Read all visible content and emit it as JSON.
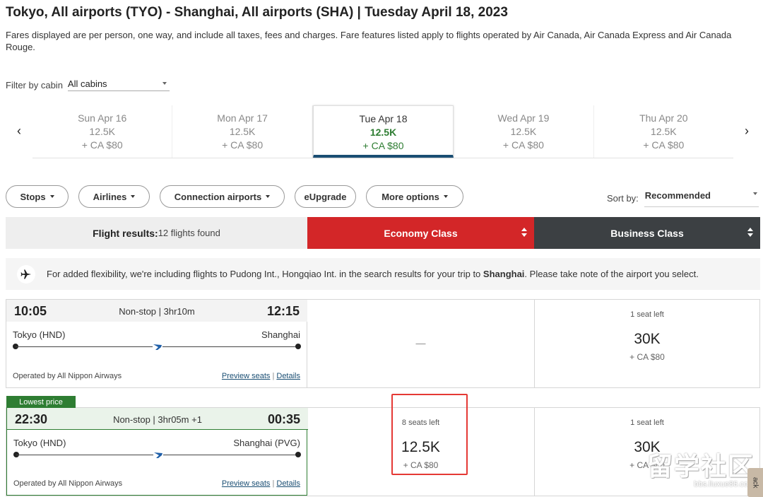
{
  "route": {
    "title": "Tokyo, All airports (TYO) - Shanghai, All airports (SHA)  |  Tuesday April 18, 2023",
    "disclaimer": "Fares displayed are per person, one way, and include all taxes, fees and charges. Fare features listed apply to flights operated by Air Canada, Air Canada Express and Air Canada Rouge."
  },
  "filter": {
    "label": "Filter by cabin",
    "value": "All cabins"
  },
  "date_nav": {
    "prev_icon": "‹",
    "next_icon": "›",
    "dates": [
      {
        "day": "Sun Apr 16",
        "points": "12.5K",
        "fee": "+ CA $80"
      },
      {
        "day": "Mon Apr 17",
        "points": "12.5K",
        "fee": "+ CA $80"
      },
      {
        "day": "Tue Apr 18",
        "points": "12.5K",
        "fee": "+ CA $80",
        "selected": true
      },
      {
        "day": "Wed Apr 19",
        "points": "12.5K",
        "fee": "+ CA $80"
      },
      {
        "day": "Thu Apr 20",
        "points": "12.5K",
        "fee": "+ CA $80"
      }
    ]
  },
  "filters": [
    "Stops",
    "Airlines",
    "Connection airports",
    "eUpgrade",
    "More options"
  ],
  "sort": {
    "label": "Sort by:",
    "value": "Recommended"
  },
  "results": {
    "summary_label": "Flight results:",
    "summary_count": "12 flights found",
    "economy_label": "Economy Class",
    "business_label": "Business Class"
  },
  "banner": {
    "text_before": "For added flexibility, we're including flights to Pudong Int., Hongqiao Int. in the search results for your trip to ",
    "city": "Shanghai",
    "text_after": ". Please take note of the airport you select."
  },
  "flights": [
    {
      "depart": "10:05",
      "arrive": "12:15",
      "duration": "Non-stop | 3hr10m",
      "from": "Tokyo (HND)",
      "to": "Shanghai",
      "operated": "Operated by All Nippon Airways",
      "preview": "Preview seats",
      "separator": "|",
      "details": "Details",
      "economy": {
        "unavailable": "—"
      },
      "business": {
        "seats": "1 seat left",
        "points": "30K",
        "fee": "+  CA $80"
      }
    },
    {
      "tag": "Lowest price",
      "depart": "22:30",
      "arrive": "00:35",
      "duration": "Non-stop | 3hr05m +1",
      "from": "Tokyo (HND)",
      "to": "Shanghai (PVG)",
      "operated": "Operated by All Nippon Airways",
      "preview": "Preview seats",
      "separator": "|",
      "details": "Details",
      "economy": {
        "seats": "8 seats left",
        "points": "12.5K",
        "fee": "+  CA $80"
      },
      "business": {
        "seats": "1 seat left",
        "points": "30K",
        "fee": "+  CA $80"
      }
    }
  ],
  "watermark": {
    "main": "留学社区",
    "sub": "bbs.liuxue86.com"
  },
  "side_tab": "ack",
  "colors": {
    "economy_header": "#d32628",
    "business_header": "#3c4043",
    "accent_green": "#2e7d32",
    "highlight": "#e53935",
    "link": "#1a4e73"
  }
}
